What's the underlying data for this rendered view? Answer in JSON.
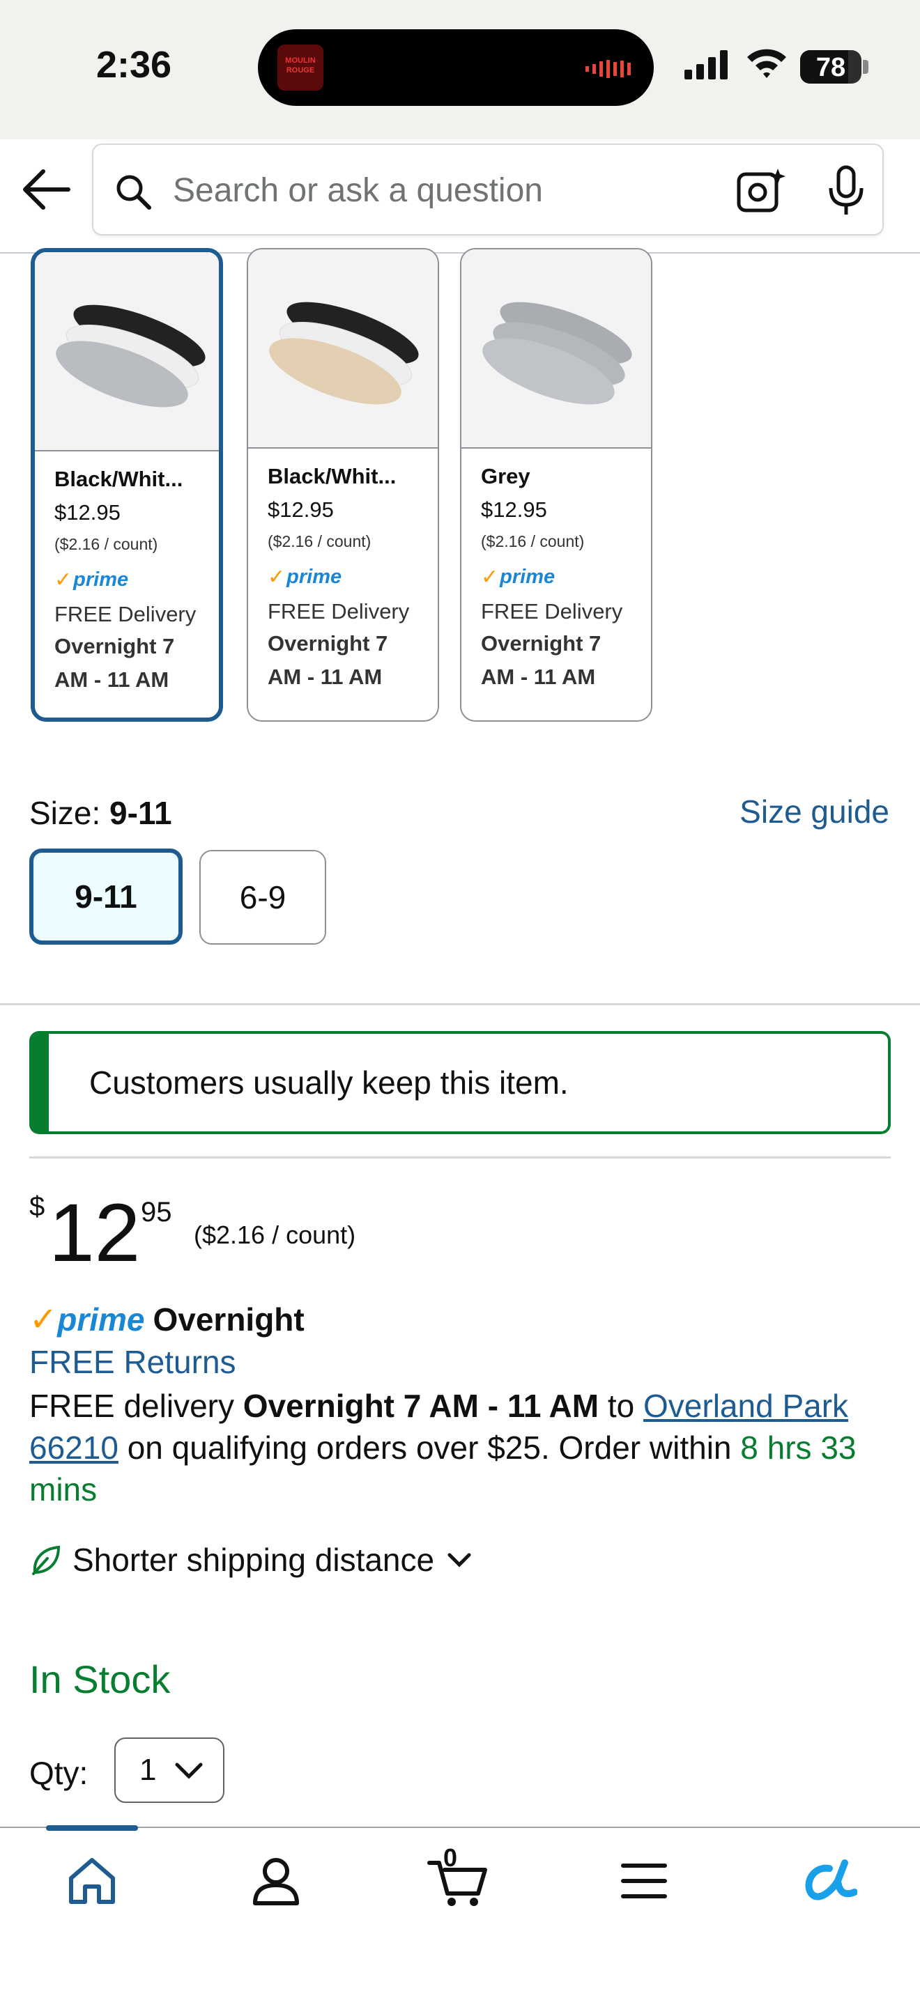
{
  "status_bar": {
    "time": "2:36",
    "battery": "78",
    "media_art_text": "MOULIN ROUGE"
  },
  "search": {
    "placeholder": "Search or ask a question"
  },
  "swatches": [
    {
      "name": "Black/Whit...",
      "price": "$12.95",
      "per_count": "($2.16 / count)",
      "prime": "prime",
      "delivery": "FREE Delivery",
      "window": "Overnight 7 AM - 11 AM",
      "selected": true
    },
    {
      "name": "Black/Whit...",
      "price": "$12.95",
      "per_count": "($2.16 / count)",
      "prime": "prime",
      "delivery": "FREE Delivery",
      "window": "Overnight 7 AM - 11 AM",
      "selected": false
    },
    {
      "name": "Grey",
      "price": "$12.95",
      "per_count": "($2.16 / count)",
      "prime": "prime",
      "delivery": "FREE Delivery",
      "window": "Overnight 7 AM - 11 AM",
      "selected": false
    }
  ],
  "size": {
    "label": "Size: ",
    "value": "9-11",
    "guide": "Size guide",
    "options": [
      "9-11",
      "6-9"
    ],
    "selected": "9-11"
  },
  "keep_banner": "Customers usually keep this item.",
  "price": {
    "currency": "$",
    "whole": "12",
    "fraction": "95",
    "per_count": "($2.16 / count)"
  },
  "prime_overnight": {
    "prime": "prime",
    "label": "Overnight"
  },
  "free_returns": "FREE Returns",
  "delivery": {
    "prefix": "FREE delivery ",
    "window": "Overnight 7 AM - 11 AM",
    "to": " to ",
    "location": "Overland Park 66210",
    "mid": " on qualifying orders over $25. Order within ",
    "countdown": "8 hrs 33 mins"
  },
  "shipping_note": "Shorter shipping distance",
  "stock": "In Stock",
  "qty": {
    "label": "Qty:",
    "value": "1"
  },
  "cart_count": "0",
  "colors": {
    "accent": "#1d5b91",
    "green": "#067d2f",
    "prime_blue": "#1a86d6",
    "prime_orange": "#ff9900"
  }
}
